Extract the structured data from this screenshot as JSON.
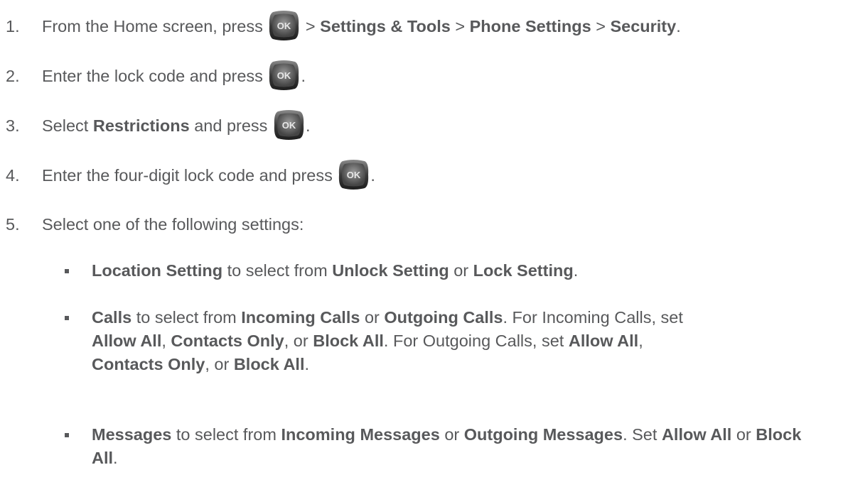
{
  "steps": [
    {
      "number": "1.",
      "parts": {
        "a": "From the Home screen, press",
        "b": ">",
        "c": "Settings & Tools",
        "d": ">",
        "e": "Phone Settings",
        "f": ">",
        "g": "Security",
        "h": "."
      }
    },
    {
      "number": "2.",
      "parts": {
        "a": "Enter the lock code and press",
        "b": "."
      }
    },
    {
      "number": "3.",
      "parts": {
        "a": "Select",
        "b": "Restrictions",
        "c": "and press",
        "d": "."
      }
    },
    {
      "number": "4.",
      "parts": {
        "a": "Enter the four-digit lock code and press",
        "b": "."
      }
    },
    {
      "number": "5.",
      "parts": {
        "a": "Select one of the following settings:"
      }
    }
  ],
  "ok_button": {
    "label": "OK",
    "icon": "ok-key-icon"
  },
  "bullets": [
    {
      "parts": {
        "a": "Location Setting",
        "b": "to select from",
        "c": "Unlock Setting",
        "d": "or",
        "e": "Lock Setting",
        "f": "."
      }
    },
    {
      "parts": {
        "a": "Calls",
        "b": "to select from",
        "c": "Incoming Calls",
        "d": "or",
        "e": "Outgoing Calls",
        "f": ". For Incoming Calls, set",
        "g": "Allow All",
        "h": ",",
        "i": "Contacts Only",
        "j": ", or",
        "k": "Block All",
        "l": ". For Outgoing Calls, set",
        "m": "Allow All",
        "n": ",",
        "o": "Contacts Only",
        "p": ", or",
        "q": "Block All",
        "r": "."
      }
    },
    {
      "parts": {
        "a": "Messages",
        "b": "to select from",
        "c": "Incoming Messages",
        "d": "or",
        "e": "Outgoing Messages",
        "f": ". Set",
        "g": "Allow All",
        "h": "or",
        "i": "Block All",
        "j": "."
      }
    }
  ],
  "colors": {
    "text": "#58595b",
    "button_dark": "#2b2b2b",
    "button_light": "#6e6e6e"
  }
}
